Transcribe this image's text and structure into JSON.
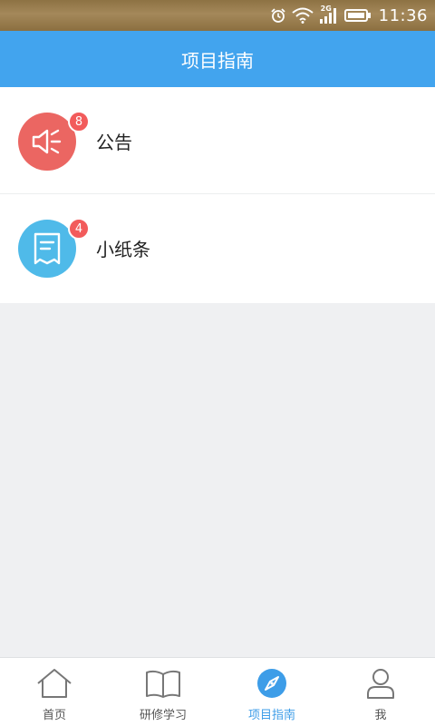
{
  "status_bar": {
    "time": "11:36",
    "network": "2G",
    "icons": [
      "alarm-icon",
      "wifi-icon",
      "signal-icon",
      "battery-icon"
    ]
  },
  "header": {
    "title": "项目指南"
  },
  "list": [
    {
      "label": "公告",
      "badge": "8",
      "icon": "megaphone-icon",
      "color": "#eb6662"
    },
    {
      "label": "小纸条",
      "badge": "4",
      "icon": "note-icon",
      "color": "#4fbae9"
    }
  ],
  "tabs": [
    {
      "label": "首页",
      "icon": "home-icon",
      "active": false
    },
    {
      "label": "研修学习",
      "icon": "book-icon",
      "active": false
    },
    {
      "label": "项目指南",
      "icon": "compass-icon",
      "active": true
    },
    {
      "label": "我",
      "icon": "person-icon",
      "active": false
    }
  ],
  "colors": {
    "accent": "#42a4ee",
    "active_tab": "#3d9de8",
    "badge": "#f25b5b",
    "background": "#eff0f2"
  }
}
